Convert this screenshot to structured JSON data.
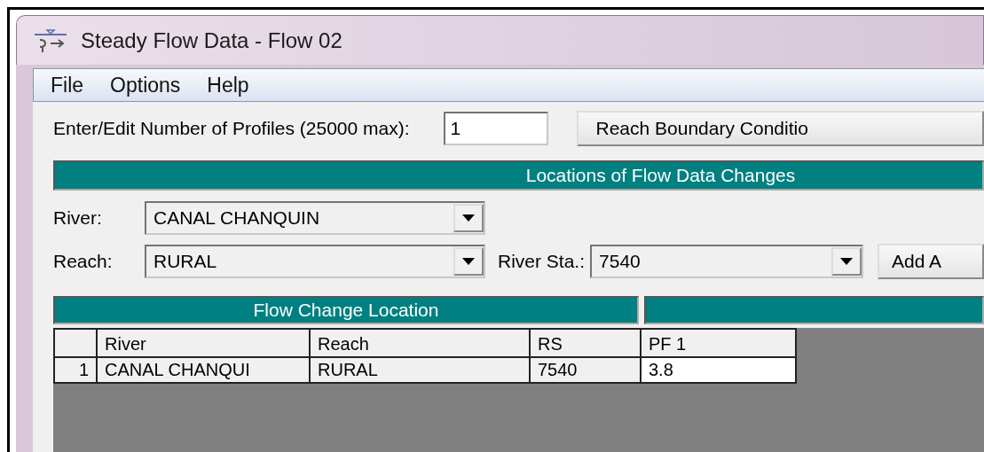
{
  "window": {
    "title": "Steady Flow Data - Flow 02"
  },
  "menu": [
    "File",
    "Options",
    "Help"
  ],
  "profiles": {
    "label": "Enter/Edit Number of Profiles (25000 max):",
    "value": "1"
  },
  "boundary_button": "Reach Boundary Conditio",
  "locations_header": "Locations of Flow Data Changes",
  "river": {
    "label": "River:",
    "value": "CANAL CHANQUIN"
  },
  "reach": {
    "label": "Reach:",
    "value": "RURAL"
  },
  "river_sta": {
    "label": "River Sta.:",
    "value": "7540"
  },
  "add_button": "Add A",
  "table": {
    "group_header": "Flow Change Location",
    "columns": [
      {
        "label": "River",
        "editable": false
      },
      {
        "label": "Reach",
        "editable": false
      },
      {
        "label": "RS",
        "editable": false
      },
      {
        "label": "PF 1",
        "editable": true
      }
    ],
    "rows": [
      {
        "number": "1",
        "cells": [
          "CANAL CHANQUI",
          "RURAL",
          "7540",
          "3.8"
        ]
      }
    ]
  }
}
